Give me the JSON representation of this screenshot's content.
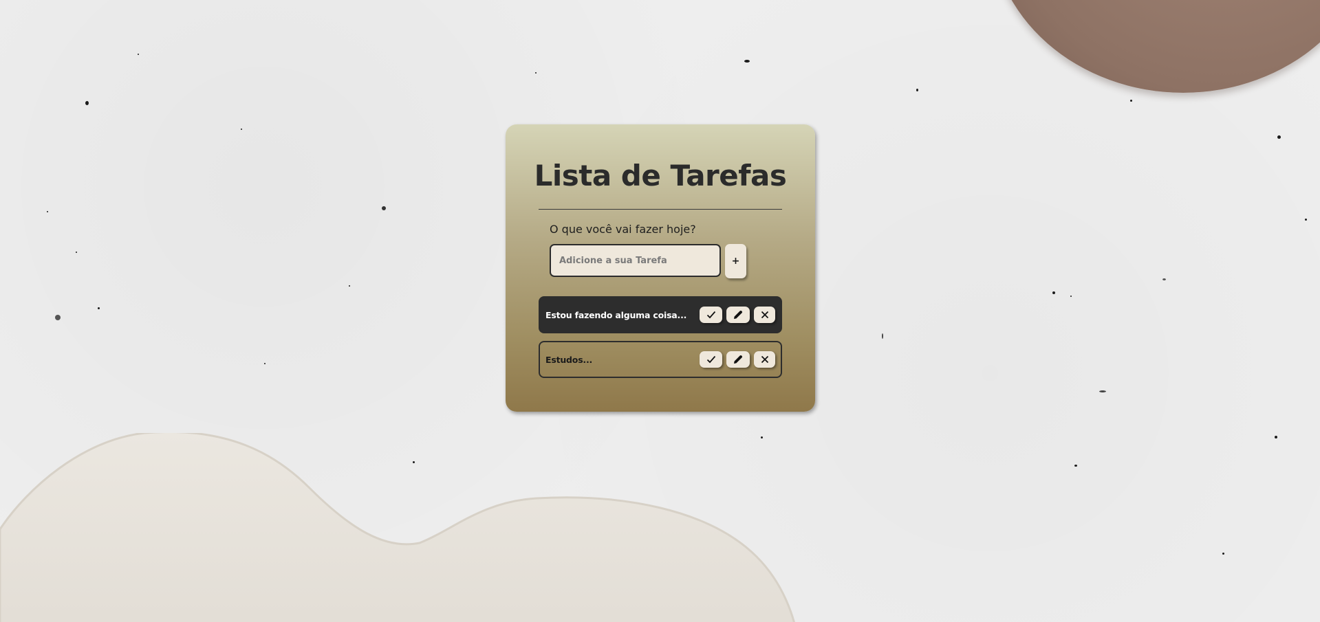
{
  "app": {
    "title": "Lista de Tarefas",
    "prompt": "O que você vai fazer hoje?"
  },
  "input": {
    "placeholder": "Adicione a sua Tarefa",
    "value": ""
  },
  "add_button": {
    "label": "+"
  },
  "tasks": [
    {
      "text": "Estou fazendo alguma coisa...",
      "done": true
    },
    {
      "text": "Estudos...",
      "done": false
    }
  ],
  "icons": {
    "check": "check-icon",
    "edit": "pencil-icon",
    "remove": "x-icon"
  },
  "colors": {
    "card_top": "#d5d4b6",
    "card_bottom": "#8f784a",
    "task_done_bg": "#2d2d2d",
    "button_bg": "#efe8dc",
    "text_dark": "#2b2b2b"
  }
}
